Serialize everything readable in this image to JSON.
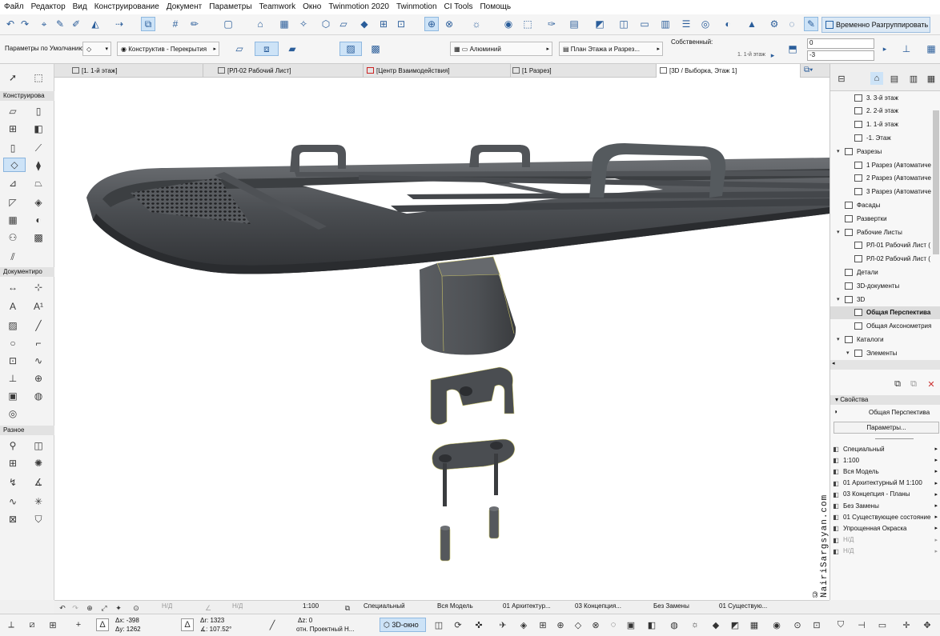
{
  "menu": [
    "Файл",
    "Редактор",
    "Вид",
    "Конструирование",
    "Документ",
    "Параметры",
    "Teamwork",
    "Окно",
    "Twinmotion 2020",
    "Twinmotion",
    "CI Tools",
    "Помощь"
  ],
  "toolbar": {
    "regroup_label": "Временно Разгруппировать"
  },
  "infobox": {
    "defaults_label": "Параметры по Умолчанию",
    "structure": "Конструктив - Перекрытия",
    "material": "Алюминий",
    "views": "План Этажа и Разрез...",
    "own_label": "Собственный:",
    "own_floor": "1. 1-й этаж",
    "value_top": "0",
    "value_bottom": "-3"
  },
  "tabs": [
    {
      "label": "[1. 1-й этаж]"
    },
    {
      "label": "[РЛ-02 Рабочий Лист]"
    },
    {
      "label": "[Центр Взаимодействия]"
    },
    {
      "label": "[1 Разрез]"
    },
    {
      "label": "[3D / Выборка, Этаж 1]"
    }
  ],
  "toolbox": {
    "design": "Конструирова",
    "document": "Документиро",
    "misc": "Разное"
  },
  "navigator": {
    "items": [
      {
        "label": "3. 3-й этаж",
        "indent": 2,
        "twist": ""
      },
      {
        "label": "2. 2-й этаж",
        "indent": 2,
        "twist": ""
      },
      {
        "label": "1. 1-й этаж",
        "indent": 2,
        "twist": ""
      },
      {
        "label": "-1. Этаж",
        "indent": 2,
        "twist": ""
      },
      {
        "label": "Разрезы",
        "indent": 1,
        "twist": "v"
      },
      {
        "label": "1 Разрез (Автоматиче",
        "indent": 2,
        "twist": ""
      },
      {
        "label": "2 Разрез (Автоматиче",
        "indent": 2,
        "twist": ""
      },
      {
        "label": "3 Разрез (Автоматиче",
        "indent": 2,
        "twist": ""
      },
      {
        "label": "Фасады",
        "indent": 1,
        "twist": ""
      },
      {
        "label": "Развертки",
        "indent": 1,
        "twist": ""
      },
      {
        "label": "Рабочие Листы",
        "indent": 1,
        "twist": "v"
      },
      {
        "label": "РЛ-01 Рабочий Лист (",
        "indent": 2,
        "twist": ""
      },
      {
        "label": "РЛ-02 Рабочий Лист (",
        "indent": 2,
        "twist": ""
      },
      {
        "label": "Детали",
        "indent": 1,
        "twist": ""
      },
      {
        "label": "3D-документы",
        "indent": 1,
        "twist": ""
      },
      {
        "label": "3D",
        "indent": 1,
        "twist": "v"
      },
      {
        "label": "Общая Перспектива",
        "indent": 2,
        "twist": ""
      },
      {
        "label": "Общая Аксонометрия",
        "indent": 2,
        "twist": ""
      },
      {
        "label": "Каталоги",
        "indent": 1,
        "twist": "v"
      },
      {
        "label": "Элементы",
        "indent": 2,
        "twist": "v"
      }
    ],
    "properties_title": "Свойства",
    "view_name": "Общая Перспектива",
    "params_button": "Параметры...",
    "props": [
      {
        "label": "Специальный",
        "enabled": true
      },
      {
        "label": "1:100",
        "enabled": true
      },
      {
        "label": "Вся Модель",
        "enabled": true
      },
      {
        "label": "01 Архитектурный М 1:100",
        "enabled": true
      },
      {
        "label": "03 Концепция - Планы",
        "enabled": true
      },
      {
        "label": "Без Замены",
        "enabled": true
      },
      {
        "label": "01 Существующее состояние",
        "enabled": true
      },
      {
        "label": "Упрощенная Окраска",
        "enabled": true
      },
      {
        "label": "Н/Д",
        "enabled": false
      },
      {
        "label": "Н/Д",
        "enabled": false
      }
    ]
  },
  "watermark": "© NairiSargsyan.com",
  "statusbar": {
    "nd1": "Н/Д",
    "nd2": "Н/Д",
    "scale": "1:100",
    "layer": "Специальный",
    "model": "Вся Модель",
    "pen": "01 Архитектур...",
    "mvo": "03 Концепция...",
    "override": "Без Замены",
    "reno": "01 Существую..."
  },
  "coords": {
    "dx": "Δх: -398",
    "dy": "Δу: 1262",
    "dr": "Δr: 1323",
    "angle": "∡: 107.52°",
    "dz": "Δz: 0",
    "ref": "отн. Проектный Н...",
    "view3d": "3D-окно"
  }
}
